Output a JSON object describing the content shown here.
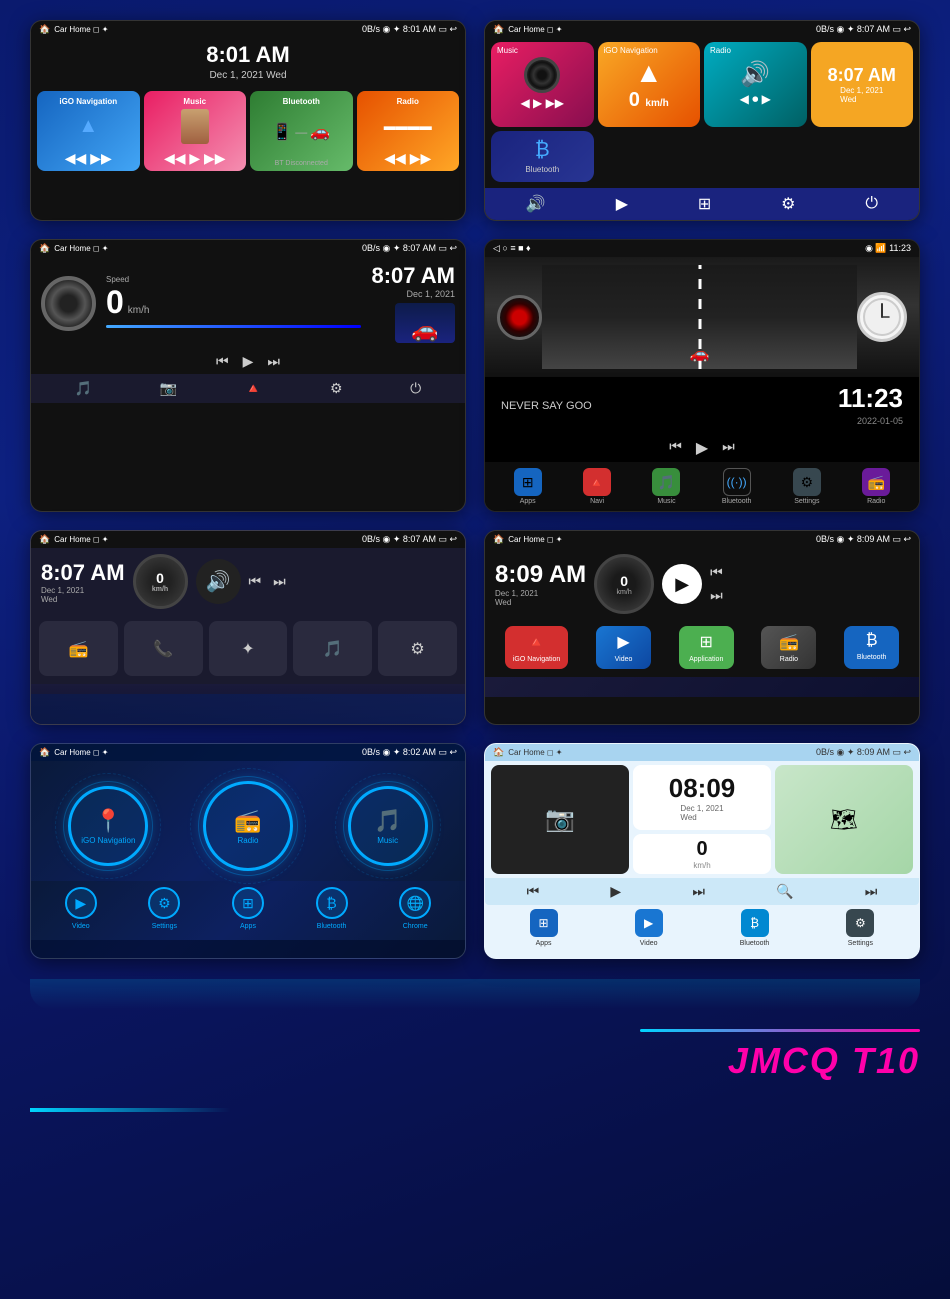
{
  "brand": {
    "name": "JMCQ",
    "model": "T10"
  },
  "screens": [
    {
      "id": "screen1",
      "statusBar": {
        "left": "Car Home ◻ ✦",
        "right": "0B/s ◉ ✦ 8:01 AM ▭ ↩"
      },
      "time": "8:01 AM",
      "date": "Dec 1, 2021 Wed",
      "apps": [
        {
          "label": "iGO Navigation",
          "color": "tile-blue",
          "icon": "🔺"
        },
        {
          "label": "Music",
          "color": "tile-pink",
          "icon": "🎵"
        },
        {
          "label": "Bluetooth",
          "color": "tile-green",
          "icon": "📱"
        },
        {
          "label": "Radio",
          "color": "tile-orange",
          "icon": "📻"
        }
      ],
      "btStatus": "BT Disconnected"
    },
    {
      "id": "screen2",
      "statusBar": {
        "left": "Car Home ◻ ✦",
        "right": "0B/s ◉ ✦ 8:07 AM ▭ ↩"
      },
      "tiles": [
        {
          "label": "Music",
          "color": "tile-music",
          "icon": "🎵"
        },
        {
          "label": "iGO Navigation",
          "color": "tile-navi",
          "icon": "🔺"
        },
        {
          "label": "Radio",
          "color": "tile-radio",
          "icon": "📻"
        }
      ],
      "time": "8:07 AM",
      "date": "Dec 1, 2021",
      "day": "Wed",
      "btLabel": "Bluetooth",
      "speed": "0",
      "speedUnit": "km/h"
    },
    {
      "id": "screen3",
      "statusBar": {
        "left": "Car Home ◻ ✦",
        "right": "0B/s ◉ ✦ 8:07 AM ▭ ↩"
      },
      "speed": "0",
      "speedLabel": "Speed",
      "speedUnit": "km/h",
      "time": "8:07 AM",
      "date": "Dec 1, 2021",
      "bottomIcons": [
        "🎵",
        "📷",
        "🔺",
        "⚙",
        "⏻"
      ]
    },
    {
      "id": "screen4",
      "statusBar": {
        "left": "◁  ○  ≡  ■  ♦",
        "right": "◉ 📶 11:23"
      },
      "songTitle": "NEVER SAY GOO",
      "time": "11:23",
      "date": "2022-01-05",
      "appIcons": [
        {
          "label": "Apps",
          "icon": "⊞",
          "class": "icon-apps"
        },
        {
          "label": "Navi",
          "icon": "🔺",
          "class": "icon-navi"
        },
        {
          "label": "Music",
          "icon": "🎵",
          "class": "icon-music"
        },
        {
          "label": "Bluetooth",
          "icon": "₿",
          "class": "icon-bt"
        },
        {
          "label": "Settings",
          "icon": "⚙",
          "class": "icon-settings"
        },
        {
          "label": "Radio",
          "icon": "📻",
          "class": "icon-radio"
        }
      ]
    },
    {
      "id": "screen5",
      "statusBar": {
        "left": "Car Home ◻ ✦",
        "right": "0B/s ◉ ✦ 8:07 AM ▭ ↩"
      },
      "time": "8:07 AM",
      "date": "Dec 1, 2021",
      "day": "Wed",
      "speedVal": "0",
      "bottomApps": [
        {
          "icon": "📻",
          "label": ""
        },
        {
          "icon": "📞",
          "label": ""
        },
        {
          "icon": "✦",
          "label": ""
        },
        {
          "icon": "🎵",
          "label": ""
        },
        {
          "icon": "⚙",
          "label": ""
        }
      ]
    },
    {
      "id": "screen6",
      "statusBar": {
        "left": "Car Home ◻ ✦",
        "right": "0B/s ◉ ✦ 8:09 AM ▭ ↩"
      },
      "time": "8:09 AM",
      "date": "Dec 1, 2021",
      "day": "Wed",
      "apps": [
        {
          "label": "iGO Navigation",
          "class": "app-navi",
          "icon": "🔺"
        },
        {
          "label": "Video",
          "class": "app-video",
          "icon": "▶"
        },
        {
          "label": "Application",
          "class": "app-application",
          "icon": "⊞"
        },
        {
          "label": "Radio",
          "class": "app-radio",
          "icon": "📻"
        },
        {
          "label": "Bluetooth",
          "class": "app-bluetooth",
          "icon": "₿"
        }
      ]
    },
    {
      "id": "screen7",
      "statusBar": {
        "left": "Car Home ◻ ✦",
        "right": "0B/s ◉ ✦ 8:02 AM ▭ ↩"
      },
      "circles": [
        {
          "label": "iGO Navigation",
          "icon": "📍"
        },
        {
          "label": "Radio",
          "icon": "📻"
        },
        {
          "label": "Music",
          "icon": "🎵"
        }
      ],
      "bottomApps": [
        {
          "label": "Video",
          "icon": "▶"
        },
        {
          "label": "Settings",
          "icon": "⚙"
        },
        {
          "label": "Apps",
          "icon": "⊞"
        },
        {
          "label": "Bluetooth",
          "icon": "₿"
        },
        {
          "label": "Chrome",
          "icon": "🌐"
        }
      ]
    },
    {
      "id": "screen8",
      "statusBar": {
        "left": "Car Home ◻ ✦",
        "right": "0B/s ◉ ✦ 8:09 AM ▭ ↩"
      },
      "time": "08:09",
      "date": "Dec 1, 2021",
      "day": "Wed",
      "speed": "0",
      "speedUnit": "km/h",
      "bottomApps": [
        {
          "label": "Apps",
          "icon": "⊞",
          "bg": "#1565c0"
        },
        {
          "label": "Video",
          "icon": "▶",
          "bg": "#1976d2"
        },
        {
          "label": "Bluetooth",
          "icon": "₿",
          "bg": "#0288d1"
        },
        {
          "label": "Settings",
          "icon": "⚙",
          "bg": "#37474f"
        }
      ]
    }
  ]
}
